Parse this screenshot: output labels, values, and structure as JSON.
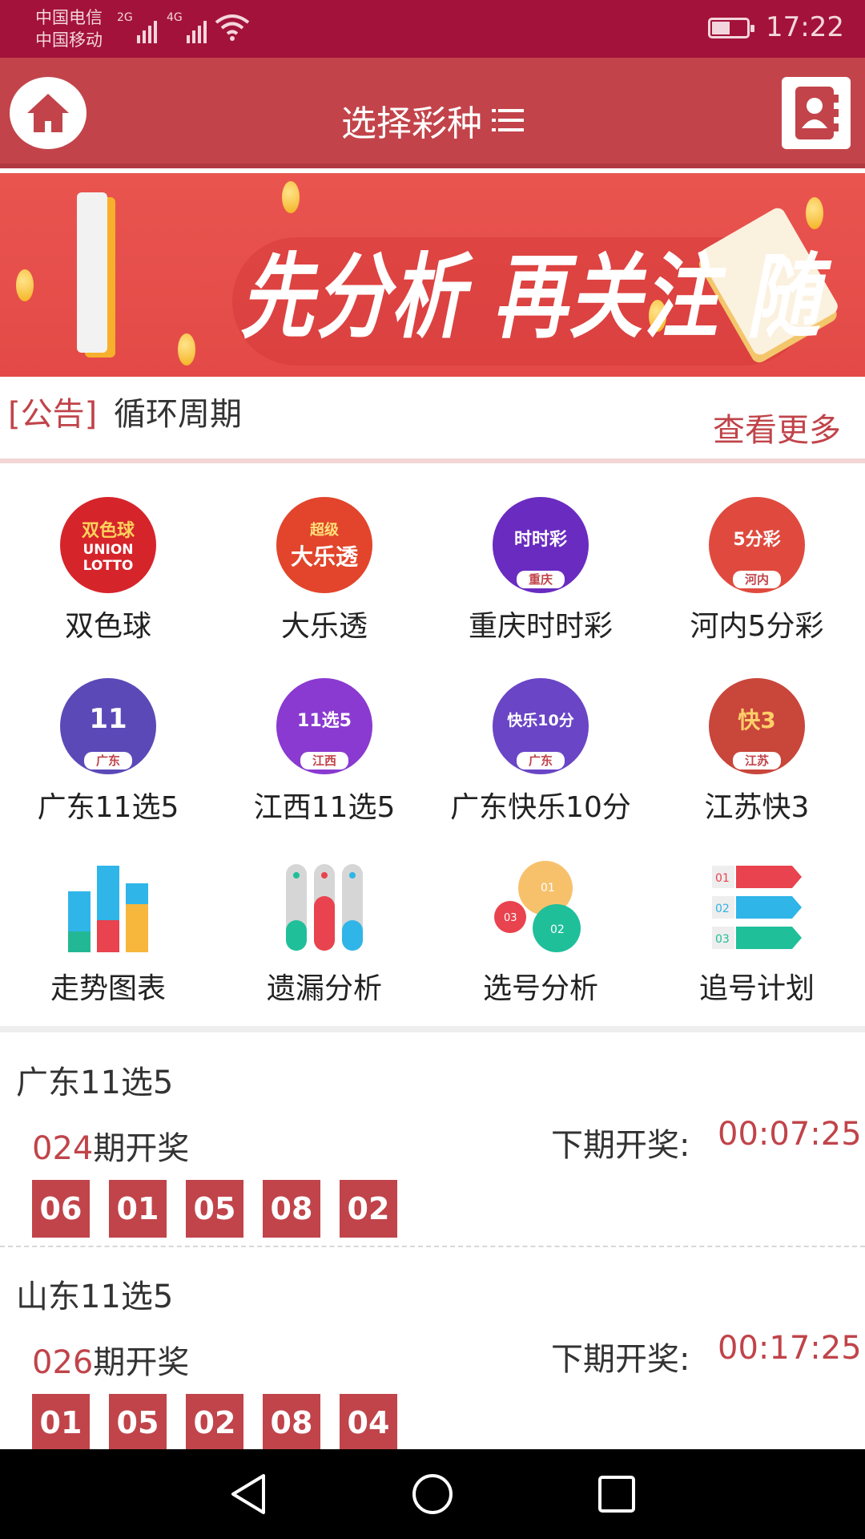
{
  "status_bar": {
    "carrier1": "中国电信",
    "carrier2": "中国移动",
    "net1": "2G",
    "net2": "4G",
    "time": "17:22"
  },
  "header": {
    "title": "选择彩种",
    "home_icon": "home-icon",
    "menu_icon": "menu-icon",
    "contact_icon": "contact-book-icon"
  },
  "banner": {
    "slogan": "先分析 再关注 随时随地测号"
  },
  "notice": {
    "tag": "[公告]",
    "text": "循环周期",
    "more": "查看更多"
  },
  "games": [
    {
      "label": "双色球",
      "logo_lines": [
        "双色球",
        "UNION",
        "LOTTO"
      ],
      "color": "#d6242b",
      "region": ""
    },
    {
      "label": "大乐透",
      "logo_lines": [
        "超级",
        "大乐透"
      ],
      "color": "#e2452b",
      "region": ""
    },
    {
      "label": "重庆时时彩",
      "logo_lines": [
        "时时彩"
      ],
      "color": "#6a2bc1",
      "region": "重庆"
    },
    {
      "label": "河内5分彩",
      "logo_lines": [
        "5分彩"
      ],
      "color": "#e04a3e",
      "region": "河内"
    },
    {
      "label": "广东11选5",
      "logo_lines": [
        "11"
      ],
      "color": "#5b49b8",
      "region": "广东"
    },
    {
      "label": "江西11选5",
      "logo_lines": [
        "11选5"
      ],
      "color": "#8a3ad0",
      "region": "江西"
    },
    {
      "label": "广东快乐10分",
      "logo_lines": [
        "快乐10分"
      ],
      "color": "#6a45c6",
      "region": "广东"
    },
    {
      "label": "江苏快3",
      "logo_lines": [
        "快3"
      ],
      "color": "#c9463a",
      "region": "江苏"
    }
  ],
  "tools": [
    {
      "label": "走势图表",
      "icon": "trend-chart-icon"
    },
    {
      "label": "遗漏分析",
      "icon": "omission-analysis-icon"
    },
    {
      "label": "选号分析",
      "icon": "number-analysis-icon"
    },
    {
      "label": "追号计划",
      "icon": "chase-plan-icon"
    }
  ],
  "results": [
    {
      "name": "广东11选5",
      "issue_num": "024",
      "issue_suffix": "期开奖",
      "next_label": "下期开奖:",
      "countdown": "00:07:25",
      "balls": [
        "06",
        "01",
        "05",
        "08",
        "02"
      ]
    },
    {
      "name": "山东11选5",
      "issue_num": "026",
      "issue_suffix": "期开奖",
      "next_label": "下期开奖:",
      "countdown": "00:17:25",
      "balls": [
        "01",
        "05",
        "02",
        "08",
        "04"
      ]
    }
  ],
  "navbar": {
    "back_icon": "back-triangle-icon",
    "home_icon": "home-circle-icon",
    "recents_icon": "recents-square-icon"
  },
  "colors": {
    "status_bar": "#a3123a",
    "header": "#c2444a",
    "accent": "#c0444a"
  }
}
